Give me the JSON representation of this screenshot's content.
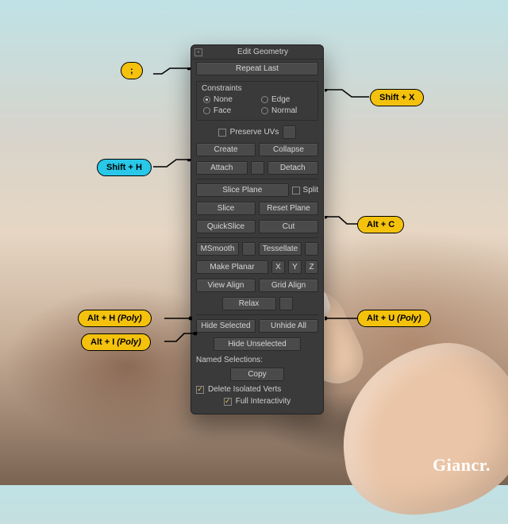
{
  "panel": {
    "title": "Edit Geometry",
    "repeat_last": "Repeat Last",
    "constraints": {
      "label": "Constraints",
      "none": "None",
      "edge": "Edge",
      "face": "Face",
      "normal": "Normal",
      "selected": "None"
    },
    "preserve_uvs": "Preserve UVs",
    "create": "Create",
    "collapse": "Collapse",
    "attach": "Attach",
    "detach": "Detach",
    "slice_plane": "Slice Plane",
    "split": "Split",
    "slice": "Slice",
    "reset_plane": "Reset Plane",
    "quickslice": "QuickSlice",
    "cut": "Cut",
    "msmooth": "MSmooth",
    "tessellate": "Tessellate",
    "make_planar": "Make Planar",
    "x": "X",
    "y": "Y",
    "z": "Z",
    "view_align": "View Align",
    "grid_align": "Grid Align",
    "relax": "Relax",
    "hide_selected": "Hide Selected",
    "unhide_all": "Unhide All",
    "hide_unselected": "Hide Unselected",
    "named_selections": "Named Selections:",
    "copy": "Copy",
    "delete_isolated": "Delete Isolated Verts",
    "full_interactivity": "Full Interactivity"
  },
  "callouts": {
    "semicolon": ";",
    "shift_x": "Shift + X",
    "shift_h": "Shift + H",
    "alt_c": "Alt + C",
    "alt_h": "Alt + H",
    "alt_h_note": "(Poly)",
    "alt_u": "Alt + U",
    "alt_u_note": "(Poly)",
    "alt_i": "Alt + I",
    "alt_i_note": "(Poly)"
  },
  "brand": "Giancr."
}
